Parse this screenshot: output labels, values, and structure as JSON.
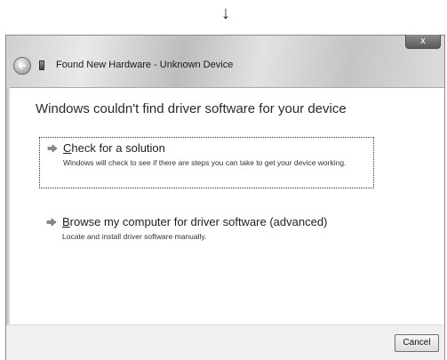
{
  "annotation": {
    "arrow_glyph": "↓"
  },
  "window": {
    "title": "Found New Hardware - Unknown Device",
    "close_label": "x"
  },
  "main": {
    "heading": "Windows couldn't find driver software for your device",
    "options": [
      {
        "accesskey": "C",
        "title_rest": "heck for a solution",
        "description": "Windows will check to see if there are steps you can take to get your device working."
      },
      {
        "accesskey": "B",
        "title_rest": "rowse my computer for driver software (advanced)",
        "description": "Locate and install driver software manually."
      }
    ]
  },
  "footer": {
    "cancel_label": "Cancel"
  },
  "colors": {
    "option_arrow": "#7a7a7a",
    "text": "#1f1f1f"
  }
}
